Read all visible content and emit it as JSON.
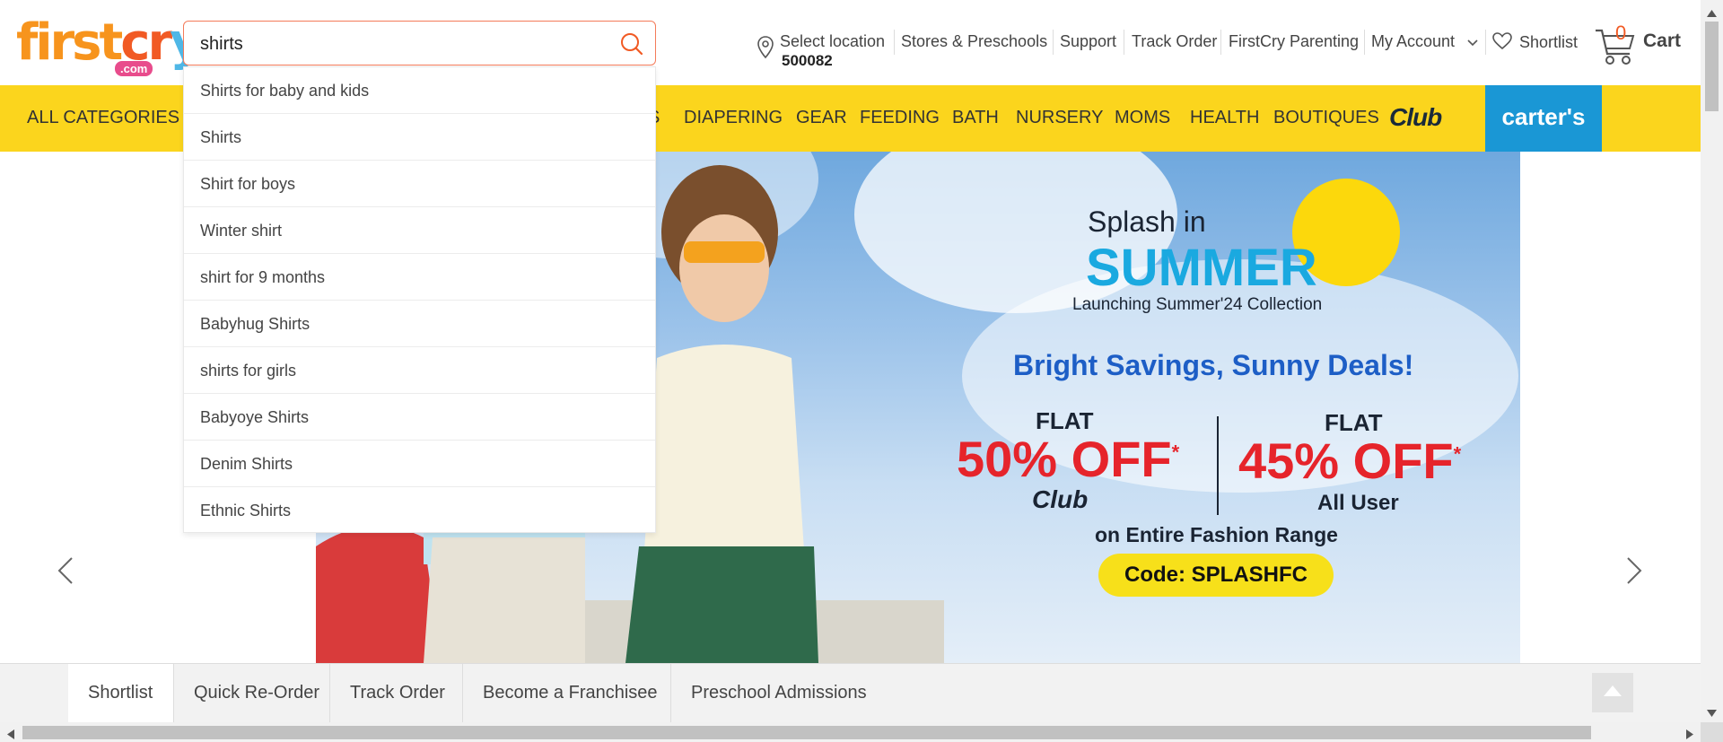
{
  "header": {
    "logo": {
      "first": "first",
      "cr": "cr",
      "y": "y",
      "com": ".com"
    },
    "search": {
      "value": "shirts",
      "icon": "search-icon"
    },
    "location": {
      "label": "Select location",
      "pincode": "500082",
      "icon": "location-pin-icon"
    },
    "links": [
      "Stores & Preschools",
      "Support",
      "Track Order",
      "FirstCry Parenting",
      "My Account"
    ],
    "shortlist": "Shortlist",
    "cart": {
      "count": "0",
      "label": "Cart",
      "icon": "cart-icon"
    }
  },
  "categories": [
    "ALL CATEGORIES",
    "S",
    "DIAPERING",
    "GEAR",
    "FEEDING",
    "BATH",
    "NURSERY",
    "MOMS",
    "HEALTH",
    "BOUTIQUES"
  ],
  "club_label": "Club",
  "carters_label": "carter's",
  "suggestions": [
    "Shirts for baby and kids",
    "Shirts",
    "Shirt for boys",
    "Winter shirt",
    "shirt for 9 months",
    "Babyhug Shirts",
    "shirts for girls",
    "Babyoye Shirts",
    "Denim Shirts",
    "Ethnic Shirts"
  ],
  "banner": {
    "line1": "Splash in",
    "line2": "SUMMER",
    "line3": "Launching Summer'24 Collection",
    "headline": "Bright Savings, Sunny Deals!",
    "flat1": "FLAT",
    "offer1": "50% OFF",
    "offer1_sub": "Club",
    "flat2": "FLAT",
    "offer2": "45% OFF",
    "offer2_sub": "All User",
    "range": "on Entire Fashion Range",
    "code": "Code: SPLASHFC",
    "star": "*"
  },
  "bottom_tabs": [
    "Shortlist",
    "Quick Re-Order",
    "Track Order",
    "Become a Franchisee",
    "Preschool Admissions"
  ],
  "colors": {
    "brand_yellow": "#fbd51d",
    "carters_blue": "#1a97d5",
    "offer_red": "#e6242b",
    "headline_blue": "#1d5ec6"
  }
}
